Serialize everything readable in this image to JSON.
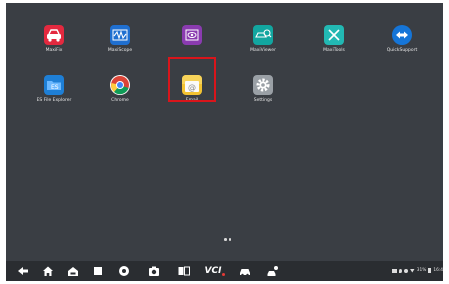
{
  "apps": [
    {
      "label": "MaxiFix",
      "icon": "car-shop-icon",
      "color": "#e3293f"
    },
    {
      "label": "MaxiScope",
      "icon": "waveform-icon",
      "color": "#1f6fd0"
    },
    {
      "label": "",
      "icon": "eye-screen-icon",
      "color": "#8a3bb0"
    },
    {
      "label": "MaxiViewer",
      "icon": "car-search-icon",
      "color": "#12a6a0"
    },
    {
      "label": "MaxiTools",
      "icon": "tools-icon",
      "color": "#22b8b3"
    },
    {
      "label": "QuickSupport",
      "icon": "teamviewer-icon",
      "color": "#1575d8"
    },
    {
      "label": "ES File Explorer",
      "icon": "folder-icon",
      "color": "#1e7fd6"
    },
    {
      "label": "Chrome",
      "icon": "chrome-icon",
      "color": "#ffffff"
    },
    {
      "label": "Email",
      "icon": "email-icon",
      "color": "#f2c232"
    },
    {
      "label": "Settings",
      "icon": "gear-icon",
      "color": "#9aa0a6"
    }
  ],
  "highlight_color": "#d9151b",
  "page_indicator_count": 2,
  "navbar": {
    "items": [
      "back-icon",
      "home-icon",
      "car-home-icon",
      "recent-apps-icon",
      "browser-icon",
      "camera-icon",
      "screenshot-icon",
      "vci-icon",
      "car-icon",
      "car-user-icon"
    ],
    "vci_text": "VCI"
  },
  "status": {
    "text": "31%",
    "time": "16:4"
  }
}
